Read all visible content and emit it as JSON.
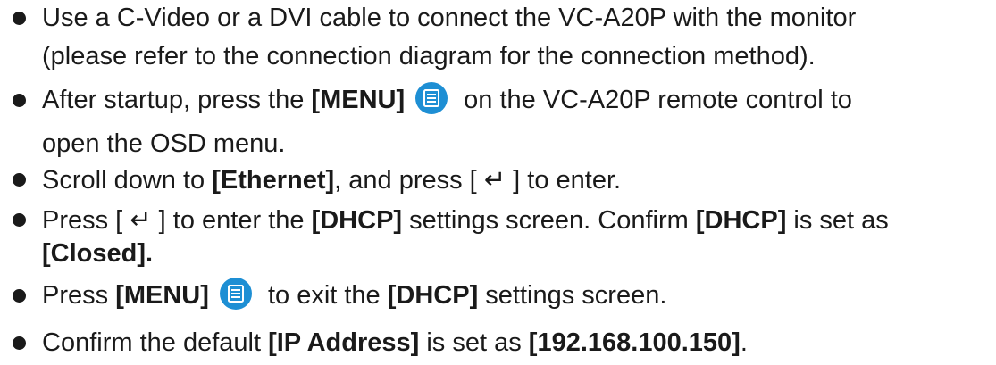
{
  "items": [
    {
      "lines": [
        {
          "segments": [
            {
              "text": "Use a C-Video or a DVI cable to connect the VC-A20P with the monitor"
            }
          ]
        },
        {
          "segments": [
            {
              "text": "(please refer to the connection diagram for the connection method)."
            }
          ]
        }
      ]
    },
    {
      "lines": [
        {
          "segments": [
            {
              "text": "After startup, press the "
            },
            {
              "text": "[MENU]",
              "bold": true
            },
            {
              "icon": "menu-icon"
            },
            {
              "text": " on the VC-A20P remote control to"
            }
          ]
        },
        {
          "segments": [
            {
              "text": "open the OSD menu."
            }
          ]
        }
      ]
    },
    {
      "lines": [
        {
          "segments": [
            {
              "text": "Scroll down to "
            },
            {
              "text": "[Ethernet]",
              "bold": true
            },
            {
              "text": ", and press [ "
            },
            {
              "text": "↵",
              "glyph": true
            },
            {
              "text": " ] to enter."
            }
          ]
        }
      ]
    },
    {
      "lines": [
        {
          "segments": [
            {
              "text": "Press [ "
            },
            {
              "text": "↵",
              "glyph": true
            },
            {
              "text": " ] to enter the "
            },
            {
              "text": "[DHCP]",
              "bold": true
            },
            {
              "text": " settings screen. Confirm "
            },
            {
              "text": "[DHCP]",
              "bold": true
            },
            {
              "text": " is set as"
            }
          ]
        },
        {
          "segments": [
            {
              "text": "[Closed].",
              "bold": true
            }
          ]
        }
      ]
    },
    {
      "lines": [
        {
          "segments": [
            {
              "text": "Press "
            },
            {
              "text": "[MENU]",
              "bold": true
            },
            {
              "icon": "menu-icon"
            },
            {
              "text": " to exit the "
            },
            {
              "text": "[DHCP]",
              "bold": true
            },
            {
              "text": " settings screen."
            }
          ]
        }
      ]
    },
    {
      "lines": [
        {
          "segments": [
            {
              "text": "Confirm the default "
            },
            {
              "text": "[IP Address]",
              "bold": true
            },
            {
              "text": " is set as "
            },
            {
              "text": "[192.168.100.150]",
              "bold": true
            },
            {
              "text": "."
            }
          ]
        }
      ]
    }
  ]
}
